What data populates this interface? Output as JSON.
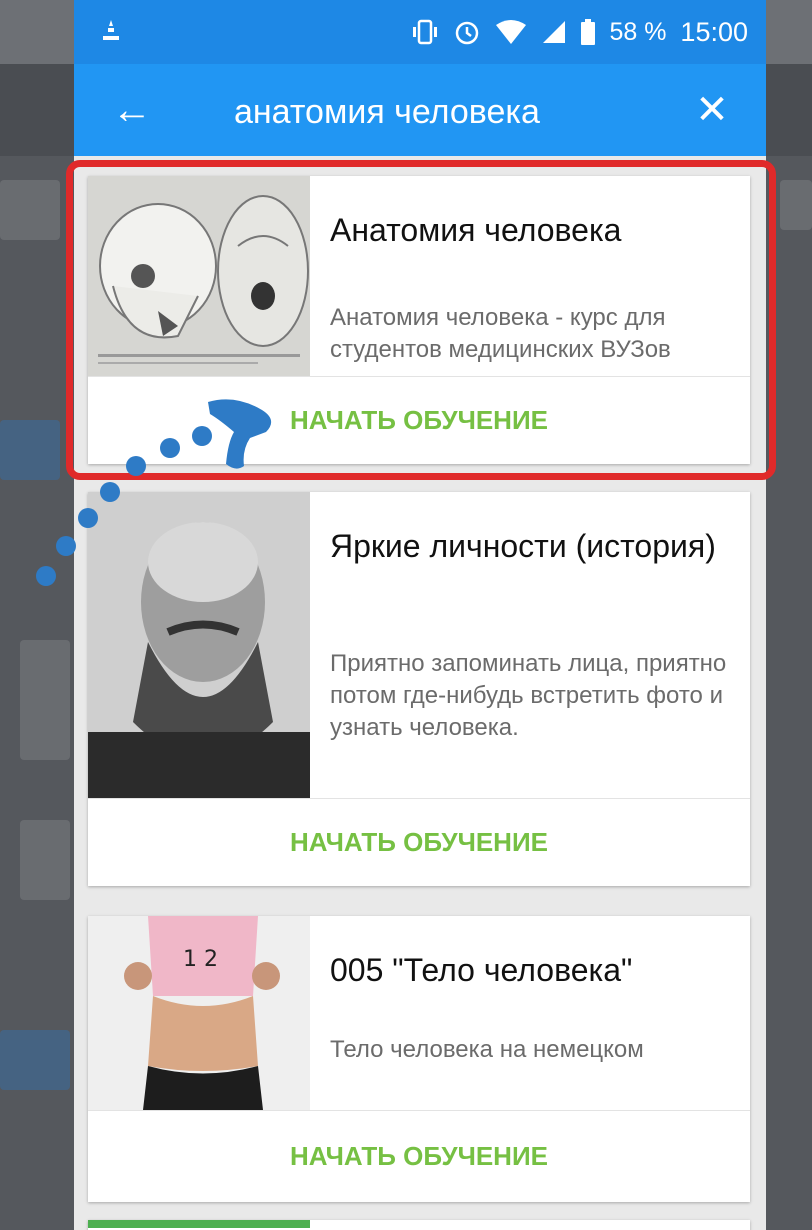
{
  "status_bar": {
    "battery": "58 %",
    "time": "15:00"
  },
  "app_bar": {
    "title": "анатомия человека"
  },
  "courses": [
    {
      "title": "Анатомия человека",
      "description": "Анатомия человека - курс для студентов медицинских ВУЗов",
      "button": "НАЧАТЬ ОБУЧЕНИЕ"
    },
    {
      "title": "Яркие личности (история)",
      "description": "Приятно запоминать лица, приятно потом где-нибудь встретить фото и узнать человека.",
      "button": "НАЧАТЬ ОБУЧЕНИЕ"
    },
    {
      "title": "005 \"Тело человека\"",
      "description": "Тело человека на немецком",
      "button": "НАЧАТЬ ОБУЧЕНИЕ"
    }
  ],
  "colors": {
    "statusbar": "#1e88e5",
    "appbar": "#2196f3",
    "accent": "#76c043",
    "highlight": "#e02a2a",
    "annotation": "#2e7bc6"
  },
  "icons": [
    "back-arrow-icon",
    "close-icon",
    "vibrate-icon",
    "alarm-icon",
    "wifi-icon",
    "signal-icon",
    "battery-icon",
    "notification-icon"
  ]
}
